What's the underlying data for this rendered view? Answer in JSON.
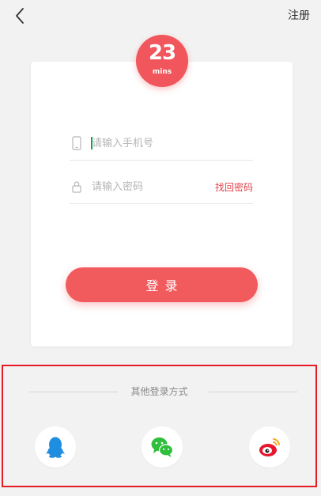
{
  "header": {
    "back_icon": "chevron-left-icon",
    "register_label": "注册"
  },
  "logo": {
    "main_text": "23",
    "sub_text": "mins",
    "color": "#f0565b"
  },
  "form": {
    "phone_placeholder": "请输入手机号",
    "phone_icon": "phone-icon",
    "password_placeholder": "请输入密码",
    "password_icon": "lock-icon",
    "forgot_label": "找回密码",
    "login_label": "登录",
    "accent_color": "#f25b5e"
  },
  "other_login": {
    "title": "其他登录方式",
    "providers": [
      {
        "name": "qq",
        "icon": "qq-icon",
        "color": "#1f8ee0"
      },
      {
        "name": "wechat",
        "icon": "wechat-icon",
        "color": "#2fbf3b"
      },
      {
        "name": "weibo",
        "icon": "weibo-icon",
        "color": "#e6162d"
      }
    ]
  }
}
